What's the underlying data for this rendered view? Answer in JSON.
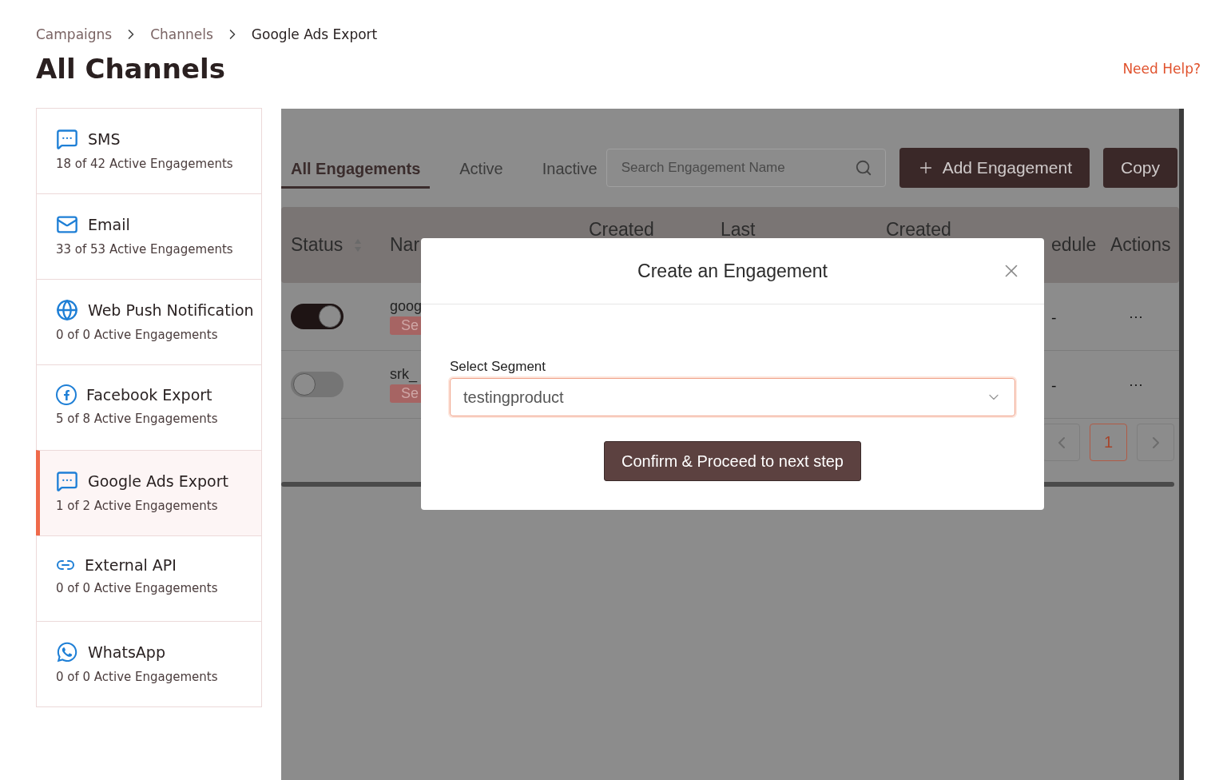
{
  "breadcrumb": [
    {
      "label": "Campaigns",
      "current": false
    },
    {
      "label": "Channels",
      "current": false
    },
    {
      "label": "Google Ads Export",
      "current": true
    }
  ],
  "title": "All Channels",
  "help_link": "Need Help?",
  "channels": [
    {
      "kind": "sms",
      "name": "SMS",
      "count": "18 of 42 Active Engagements",
      "selected": false
    },
    {
      "kind": "email",
      "name": "Email",
      "count": "33 of 53 Active Engagements",
      "selected": false
    },
    {
      "kind": "webpush",
      "name": "Web Push Notification",
      "count": "0 of 0 Active Engagements",
      "selected": false
    },
    {
      "kind": "facebook",
      "name": "Facebook Export",
      "count": "5 of 8 Active Engagements",
      "selected": false
    },
    {
      "kind": "sms",
      "name": "Google Ads Export",
      "count": "1 of 2 Active Engagements",
      "selected": true
    },
    {
      "kind": "api",
      "name": "External API",
      "count": "0 of 0 Active Engagements",
      "selected": false
    },
    {
      "kind": "whatsapp",
      "name": "WhatsApp",
      "count": "0 of 0 Active Engagements",
      "selected": false
    }
  ],
  "tabs": [
    {
      "label": "All Engagements",
      "selected": true
    },
    {
      "label": "Active",
      "selected": false
    },
    {
      "label": "Inactive",
      "selected": false
    }
  ],
  "search": {
    "placeholder": "Search Engagement Name"
  },
  "buttons": [
    {
      "kind": "add",
      "label": "Add Engagement"
    },
    {
      "kind": "plain",
      "label": "Copy"
    }
  ],
  "table": {
    "columns": [
      {
        "label": "Status",
        "sortable": true
      },
      {
        "label": "Nar"
      },
      {
        "label": "Created"
      },
      {
        "label": "Last"
      },
      {
        "label": "Created"
      },
      {
        "label": "edule"
      },
      {
        "label": "Actions"
      }
    ],
    "rows": [
      {
        "on": true,
        "name": "goog",
        "tag": "Se",
        "schedule": "-",
        "actions": "···"
      },
      {
        "on": false,
        "name": "srk_",
        "tag": "Se",
        "schedule": "-",
        "actions": "···"
      }
    ]
  },
  "pagination": {
    "page": "1"
  },
  "modal": {
    "title": "Create an Engagement",
    "field_label": "Select Segment",
    "value": "testingproduct",
    "button": "Confirm & Proceed to next step"
  }
}
